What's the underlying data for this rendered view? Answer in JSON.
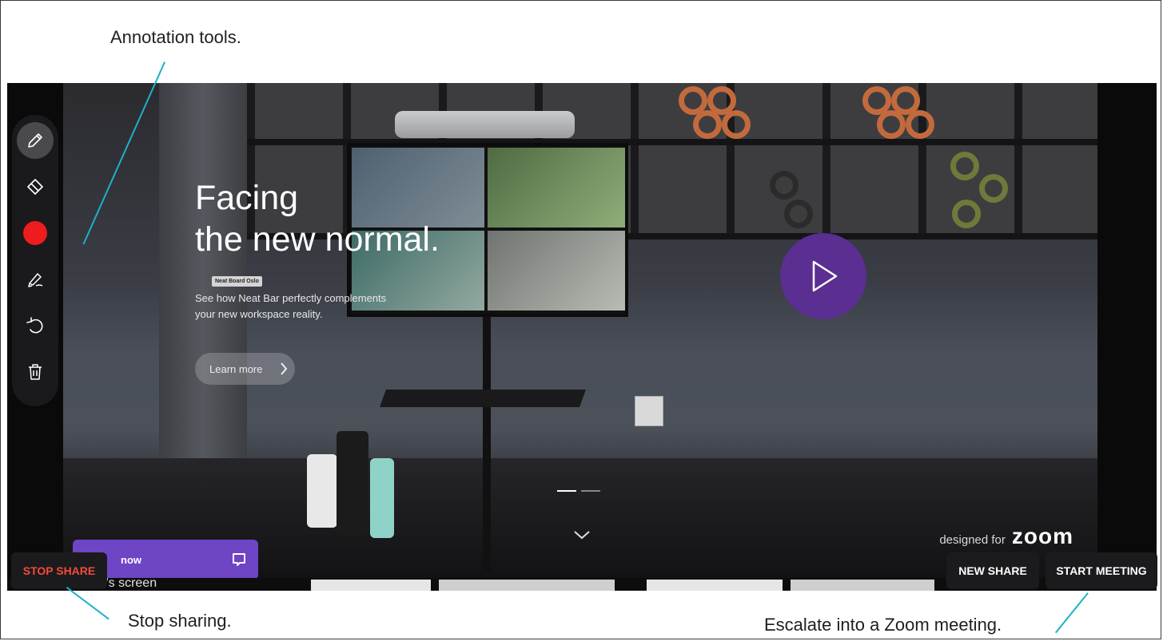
{
  "callouts": {
    "annotation_tools": "Annotation tools.",
    "stop_sharing": "Stop sharing.",
    "escalate": "Escalate into a Zoom meeting."
  },
  "hero": {
    "title_line1": "Facing",
    "title_line2": "the new normal.",
    "subtitle_line1": "See how Neat Bar perfectly complements",
    "subtitle_line2": "your new workspace reality.",
    "learn_more": "Learn more"
  },
  "device_label": "Neat Board Oslo",
  "branding": {
    "designed_for": "designed for",
    "brand": "zoom"
  },
  "chat_banner": {
    "label": "now"
  },
  "share_caption": "mstad's screen",
  "toolbar": {
    "tools": [
      "pen-icon",
      "eraser-icon",
      "color-red",
      "highlighter-icon",
      "undo-icon",
      "trash-icon"
    ],
    "accent_color": "#ee1c1c"
  },
  "controls": {
    "stop_share": "STOP SHARE",
    "new_share": "NEW SHARE",
    "start_meeting": "START MEETING"
  },
  "colors": {
    "play_button": "#5b2e91",
    "chat_banner": "#6d45c5",
    "callout_line": "#1eb1c8",
    "stop_share_text": "#f24a3b"
  }
}
